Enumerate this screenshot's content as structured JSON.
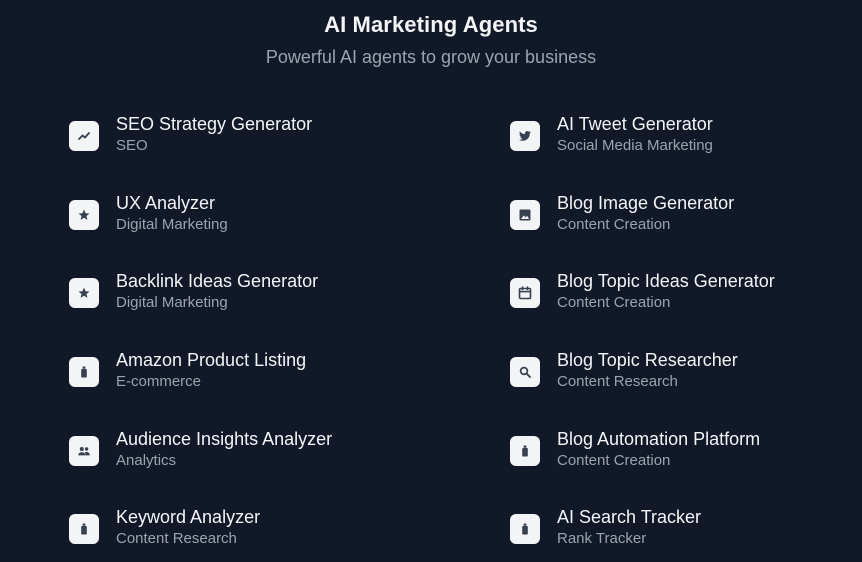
{
  "header": {
    "title": "AI Marketing Agents",
    "subtitle": "Powerful AI agents to grow your business"
  },
  "agents": [
    {
      "name": "SEO Strategy Generator",
      "category": "SEO",
      "icon": "trending-up-icon"
    },
    {
      "name": "AI Tweet Generator",
      "category": "Social Media Marketing",
      "icon": "twitter-icon"
    },
    {
      "name": "UX Analyzer",
      "category": "Digital Marketing",
      "icon": "star-icon"
    },
    {
      "name": "Blog Image Generator",
      "category": "Content Creation",
      "icon": "image-icon"
    },
    {
      "name": "Backlink Ideas Generator",
      "category": "Digital Marketing",
      "icon": "star-icon"
    },
    {
      "name": "Blog Topic Ideas Generator",
      "category": "Content Creation",
      "icon": "calendar-icon"
    },
    {
      "name": "Amazon Product Listing",
      "category": "E-commerce",
      "icon": "bottle-icon"
    },
    {
      "name": "Blog Topic Researcher",
      "category": "Content Research",
      "icon": "search-icon"
    },
    {
      "name": "Audience Insights Analyzer",
      "category": "Analytics",
      "icon": "people-icon"
    },
    {
      "name": "Blog Automation Platform",
      "category": "Content Creation",
      "icon": "bottle-icon"
    },
    {
      "name": "Keyword Analyzer",
      "category": "Content Research",
      "icon": "bottle-icon"
    },
    {
      "name": "AI Search Tracker",
      "category": "Rank Tracker",
      "icon": "bottle-icon"
    }
  ],
  "colors": {
    "background": "#111827",
    "icon_tile": "#f3f4f6",
    "icon_glyph": "#374151",
    "title_text": "#f3f4f6",
    "muted_text": "#9ca3af"
  }
}
